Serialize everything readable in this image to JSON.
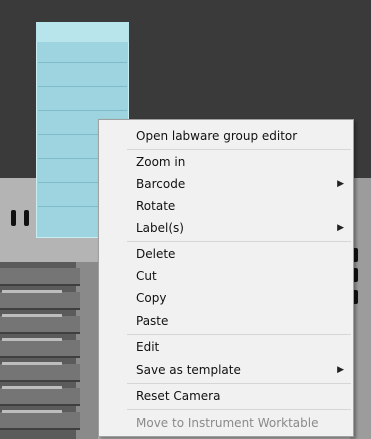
{
  "context_menu": {
    "items": [
      {
        "label": "Open labware group editor",
        "submenu": false,
        "enabled": true
      },
      {
        "label": "Zoom in",
        "submenu": false,
        "enabled": true
      },
      {
        "label": "Barcode",
        "submenu": true,
        "enabled": true
      },
      {
        "label": "Rotate",
        "submenu": false,
        "enabled": true
      },
      {
        "label": "Label(s)",
        "submenu": true,
        "enabled": true
      },
      {
        "label": "Delete",
        "submenu": false,
        "enabled": true
      },
      {
        "label": "Cut",
        "submenu": false,
        "enabled": true
      },
      {
        "label": "Copy",
        "submenu": false,
        "enabled": true
      },
      {
        "label": "Paste",
        "submenu": false,
        "enabled": true
      },
      {
        "label": "Edit",
        "submenu": false,
        "enabled": true
      },
      {
        "label": "Save as template",
        "submenu": true,
        "enabled": true
      },
      {
        "label": "Reset Camera",
        "submenu": false,
        "enabled": true
      },
      {
        "label": "Move to Instrument Worktable",
        "submenu": false,
        "enabled": false
      }
    ],
    "submenu_arrow": "▶"
  },
  "colors": {
    "menu_bg": "#f1f1f1",
    "disabled_text": "#8a8a8a",
    "labware_tube": "#9ed4df"
  }
}
